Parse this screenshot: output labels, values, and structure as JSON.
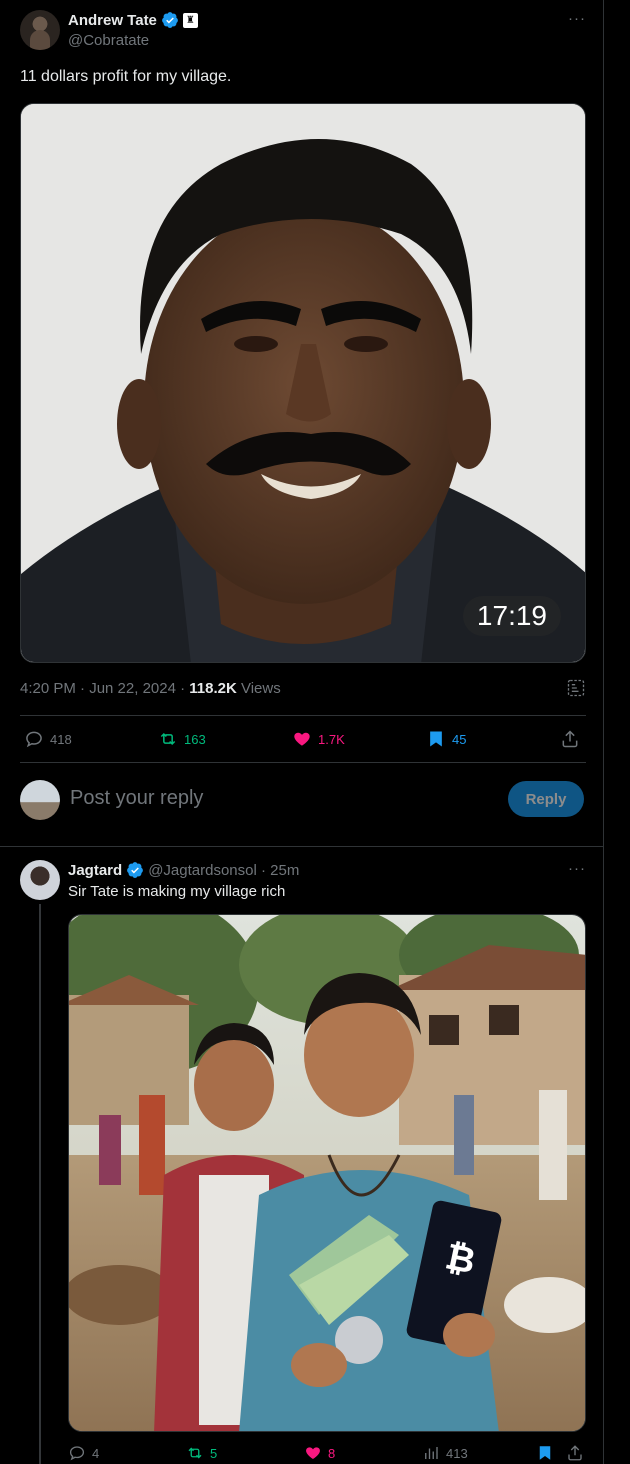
{
  "main_tweet": {
    "author_name": "Andrew Tate",
    "handle": "@Cobratate",
    "more": "···",
    "text": "11 dollars profit for my village.",
    "media_time_badge": "17:19",
    "timestamp": "4:20 PM · Jun 22, 2024 · ",
    "views_count": "118.2K",
    "views_label": " Views",
    "actions": {
      "replies": "418",
      "reposts": "163",
      "likes": "1.7K",
      "bookmarks": "45"
    }
  },
  "reply_composer": {
    "placeholder": "Post your reply",
    "button_label": "Reply"
  },
  "reply_tweet": {
    "author_name": "Jagtard",
    "handle_time": "@Jagtardsonsol · 25m",
    "more": "···",
    "text": "Sir Tate is making my village rich",
    "actions": {
      "replies": "4",
      "reposts": "5",
      "likes": "8",
      "views": "413"
    }
  },
  "colors": {
    "accent": "#1d9bf0",
    "repost": "#00ba7c",
    "like": "#f91880",
    "muted": "#71767b"
  }
}
